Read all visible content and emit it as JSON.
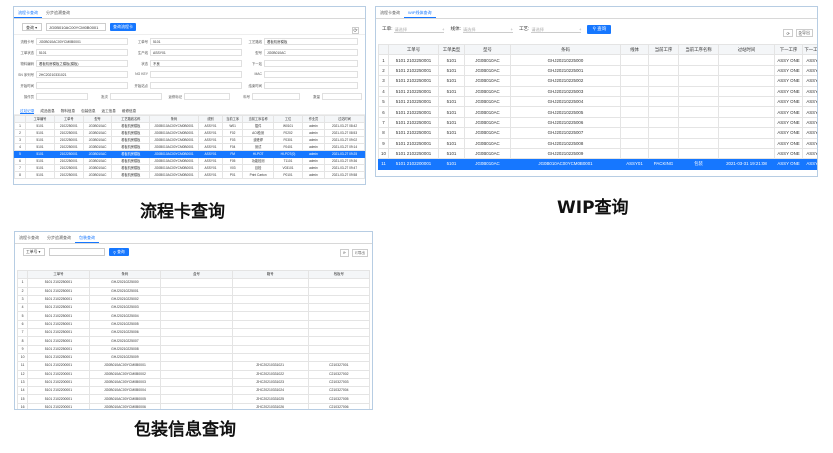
{
  "panel1": {
    "tabs": [
      "流程卡查询",
      "分步追溯查询"
    ],
    "search": {
      "select": "查询",
      "value": "JG0B010AC00YCM0B0001",
      "button": "查询流程卡"
    },
    "form": [
      [
        [
          "流程卡号",
          "JG0B010AC00YCM0B0001"
        ],
        [
          "工单号",
          "5101"
        ],
        [
          "工艺路线",
          "看板机房模板"
        ]
      ],
      [
        [
          "工单状态",
          "5101"
        ],
        [
          "生产线",
          "ASSY01"
        ],
        [
          "型号",
          "JG0B010AC"
        ]
      ],
      [
        [
          "物料编码",
          "看板机房模板之模板(模板)"
        ],
        [
          "状态",
          "不良"
        ],
        [
          "下一站",
          ""
        ]
      ],
      [
        [
          "SN 序列号",
          "2HC20210331021"
        ],
        [
          "NG KEY",
          ""
        ],
        [
          "MAC",
          ""
        ]
      ],
      [
        [
          "开始时间",
          ""
        ],
        [
          "开始站点",
          ""
        ],
        [
          "结束时间",
          ""
        ]
      ],
      [
        [
          "操作员",
          ""
        ],
        [
          "批次",
          ""
        ],
        [
          "返修标记",
          ""
        ],
        [
          "料号",
          ""
        ],
        [
          "数量",
          ""
        ]
      ]
    ],
    "subtabs": [
      "过站记录",
      "成品信息",
      "物料信息",
      "包装信息",
      "返工信息",
      "维修信息"
    ],
    "table": {
      "headers": [
        "",
        "工单编号",
        "工单号",
        "型号",
        "工艺路线名称",
        "条码",
        "线别",
        "当前工序",
        "当前工序名称",
        "工位",
        "作业员",
        "过站时间"
      ],
      "rows": [
        [
          "1",
          "5101",
          "2102250001",
          "JG0B010AC",
          "看板机房模板",
          "JG0B010AC00YCM0B0001",
          "ASSY01",
          "W01",
          "插件",
          "W0101",
          "admin",
          "2021-03-27 08:42"
        ],
        [
          "2",
          "5101",
          "2102250001",
          "JG0B010AC",
          "看板机房模板",
          "JG0B010AC00YCM0B0001",
          "ASSY01",
          "F02",
          "AOI检测",
          "F0202",
          "admin",
          "2021-03-27 08:53"
        ],
        [
          "3",
          "5101",
          "2102250001",
          "JG0B010AC",
          "看板机房模板",
          "JG0B010AC00YCM0B0001",
          "ASSY01",
          "F03",
          "波峰焊",
          "F0301",
          "admin",
          "2021-03-27 09:02"
        ],
        [
          "4",
          "5101",
          "2102250001",
          "JG0B010AC",
          "看板机房模板",
          "JG0B010AC00YCM0B0001",
          "ASSY01",
          "F04",
          "测试",
          "F0401",
          "admin",
          "2021-03-27 09:14"
        ],
        [
          "5",
          "5101",
          "2102250001",
          "JG0B010AC",
          "看板机房模板",
          "JG0B010AC00YCM0B0001",
          "ASSY01",
          "FM",
          "HI-POT",
          "HI-POT(0)",
          "admin",
          "2021-03-27 09:25"
        ],
        [
          "6",
          "5101",
          "2102250001",
          "JG0B010AC",
          "看板机房模板",
          "JG0B010AC00YCM0B0001",
          "ASSY01",
          "F05",
          "功能检测",
          "T1101",
          "admin",
          "2021-03-27 09:36"
        ],
        [
          "7",
          "5101",
          "2102250001",
          "JG0B010AC",
          "看板机房模板",
          "JG0B010AC00YCM0B0001",
          "ASSY01",
          "V03",
          "目检",
          "V03101",
          "admin",
          "2021-03-27 09:47"
        ],
        [
          "8",
          "5101",
          "2102250001",
          "JG0B010AC",
          "看板机房模板",
          "JG0B010AC00YCM0B0001",
          "ASSY01",
          "P01",
          "Print Carton",
          "P0101",
          "admin",
          "2021-03-27 09:58"
        ]
      ],
      "selected_row": 4
    },
    "caption": "流程卡查询"
  },
  "panel2": {
    "tabs": [
      "流程卡查询",
      "WIP线体查询"
    ],
    "search": {
      "fields": [
        {
          "label": "工单:",
          "placeholder": "请选择"
        },
        {
          "label": "线体:",
          "placeholder": "请选择"
        },
        {
          "label": "工艺:",
          "placeholder": "请选择"
        }
      ],
      "button": "查询"
    },
    "tools": [
      "⟳",
      "导出"
    ],
    "table": {
      "headers": [
        "",
        "工单号",
        "工单类型",
        "型号",
        "条码",
        "线体",
        "当前工序",
        "当前工序名称",
        "过站时间",
        "下一工序",
        "下一工序名称"
      ],
      "rows": [
        [
          "1",
          "5101 2102250001",
          "5101",
          "JG0B010AC",
          "GHJ20210225000",
          "",
          "",
          "",
          "",
          "ASSY ONE",
          "ASSY ONE"
        ],
        [
          "2",
          "5101 2102250001",
          "5101",
          "JG0B010AC",
          "GHJ20210225001",
          "",
          "",
          "",
          "",
          "ASSY ONE",
          "ASSY ONE"
        ],
        [
          "3",
          "5101 2102250001",
          "5101",
          "JG0B010AC",
          "GHJ20210225002",
          "",
          "",
          "",
          "",
          "ASSY ONE",
          "ASSY ONE"
        ],
        [
          "4",
          "5101 2102250001",
          "5101",
          "JG0B010AC",
          "GHJ20210225003",
          "",
          "",
          "",
          "",
          "ASSY ONE",
          "ASSY ONE"
        ],
        [
          "5",
          "5101 2102250001",
          "5101",
          "JG0B010AC",
          "GHJ20210225004",
          "",
          "",
          "",
          "",
          "ASSY ONE",
          "ASSY ONE"
        ],
        [
          "6",
          "5101 2102250001",
          "5101",
          "JG0B010AC",
          "GHJ20210225005",
          "",
          "",
          "",
          "",
          "ASSY ONE",
          "ASSY ONE"
        ],
        [
          "7",
          "5101 2102250001",
          "5101",
          "JG0B010AC",
          "GHJ20210225006",
          "",
          "",
          "",
          "",
          "ASSY ONE",
          "ASSY ONE"
        ],
        [
          "8",
          "5101 2102250001",
          "5101",
          "JG0B010AC",
          "GHJ20210225007",
          "",
          "",
          "",
          "",
          "ASSY ONE",
          "ASSY ONE"
        ],
        [
          "9",
          "5101 2102250001",
          "5101",
          "JG0B010AC",
          "GHJ20210225008",
          "",
          "",
          "",
          "",
          "ASSY ONE",
          "ASSY ONE"
        ],
        [
          "10",
          "5101 2102250001",
          "5101",
          "JG0B010AC",
          "GHJ20210225009",
          "",
          "",
          "",
          "",
          "ASSY ONE",
          "ASSY ONE"
        ],
        [
          "11",
          "5101 2102200001",
          "5101",
          "JG0B010AC",
          "JG0B010AC00YCM0B0001",
          "ASSY01",
          "PACKING",
          "包装",
          "2021-03-31 19:21:08",
          "ASSY ONE",
          "ASSY ONE"
        ]
      ],
      "selected_row": 10
    },
    "caption": "WIP查询"
  },
  "panel3": {
    "tabs": [
      "流程卡查询",
      "分步追溯查询",
      "包装查询"
    ],
    "search": {
      "select": "工单号",
      "button": "查询"
    },
    "tools": [
      "⟳",
      "导出"
    ],
    "table": {
      "headers": [
        "",
        "工单号",
        "条码",
        "盒号",
        "箱号",
        "栈板号"
      ],
      "rows": [
        [
          "1",
          "5101 2102250001",
          "GHJ20210225000",
          "",
          "",
          ""
        ],
        [
          "2",
          "5101 2102250001",
          "GHJ20210225001",
          "",
          "",
          ""
        ],
        [
          "3",
          "5101 2102250001",
          "GHJ20210225002",
          "",
          "",
          ""
        ],
        [
          "4",
          "5101 2102250001",
          "GHJ20210225003",
          "",
          "",
          ""
        ],
        [
          "5",
          "5101 2102250001",
          "GHJ20210225004",
          "",
          "",
          ""
        ],
        [
          "6",
          "5101 2102250001",
          "GHJ20210225005",
          "",
          "",
          ""
        ],
        [
          "7",
          "5101 2102250001",
          "GHJ20210225006",
          "",
          "",
          ""
        ],
        [
          "8",
          "5101 2102250001",
          "GHJ20210225007",
          "",
          "",
          ""
        ],
        [
          "9",
          "5101 2102250001",
          "GHJ20210225008",
          "",
          "",
          ""
        ],
        [
          "10",
          "5101 2102250001",
          "GHJ20210225009",
          "",
          "",
          ""
        ],
        [
          "11",
          "5101 2102200001",
          "JG0B010AC00YCM0B0001",
          "",
          "ZHC20210331021",
          "C210327001"
        ],
        [
          "12",
          "5101 2102200001",
          "JG0B010AC00YCM0B0002",
          "",
          "ZHC20210331022",
          "C210327002"
        ],
        [
          "13",
          "5101 2102200001",
          "JG0B010AC00YCM0B0003",
          "",
          "ZHC20210331023",
          "C210327003"
        ],
        [
          "14",
          "5101 2102200001",
          "JG0B010AC00YCM0B0004",
          "",
          "ZHC20210331024",
          "C210327004"
        ],
        [
          "15",
          "5101 2102200001",
          "JG0B010AC00YCM0B0005",
          "",
          "ZHC20210331025",
          "C210327005"
        ],
        [
          "16",
          "5101 2102200001",
          "JG0B010AC00YCM0B0006",
          "",
          "ZHC20210331026",
          "C210327006"
        ]
      ]
    },
    "caption": "包装信息查询"
  }
}
